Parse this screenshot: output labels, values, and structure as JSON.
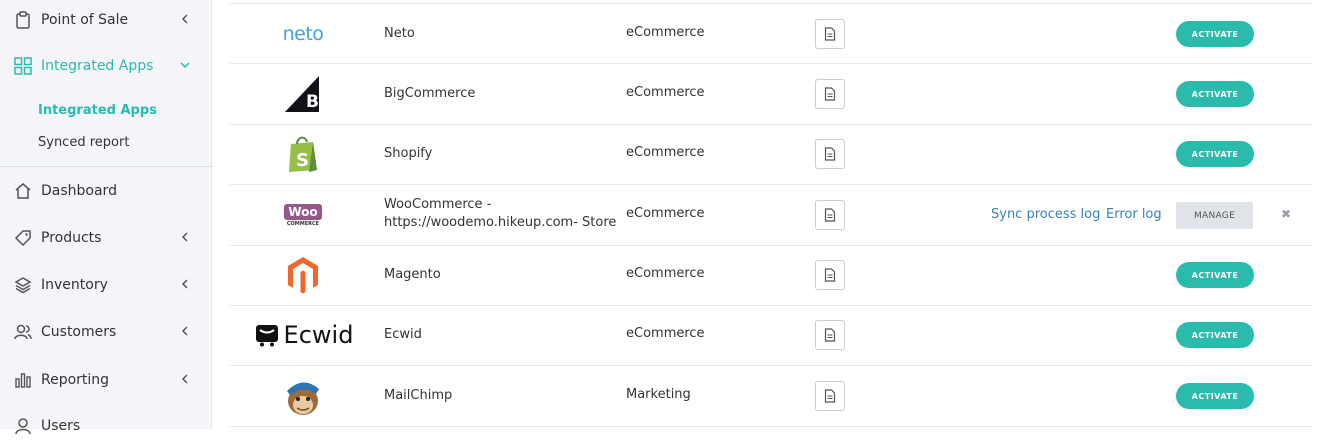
{
  "sidebar": {
    "items": [
      {
        "label": "Point of Sale",
        "icon": "clipboard-icon"
      },
      {
        "label": "Integrated Apps",
        "icon": "grid-icon"
      },
      {
        "label": "Dashboard",
        "icon": "home-icon"
      },
      {
        "label": "Products",
        "icon": "tag-icon"
      },
      {
        "label": "Inventory",
        "icon": "layers-icon"
      },
      {
        "label": "Customers",
        "icon": "users-icon"
      },
      {
        "label": "Reporting",
        "icon": "bar-chart-icon"
      },
      {
        "label": "Users",
        "icon": "user-icon"
      }
    ],
    "subitems": [
      {
        "label": "Integrated Apps"
      },
      {
        "label": "Synced report"
      }
    ]
  },
  "apps": [
    {
      "name": "Neto",
      "category": "eCommerce",
      "action": "ACTIVATE",
      "logo_text": "neto"
    },
    {
      "name": "BigCommerce",
      "category": "eCommerce",
      "action": "ACTIVATE"
    },
    {
      "name": "Shopify",
      "category": "eCommerce",
      "action": "ACTIVATE"
    },
    {
      "name_line1": "WooCommerce -",
      "name_line2": "https://woodemo.hikeup.com- Store",
      "category": "eCommerce",
      "action": "MANAGE",
      "sync_log": "Sync process log",
      "error_log": "Error log",
      "logo_text": "Woo",
      "logo_sub": "COMMERCE"
    },
    {
      "name": "Magento",
      "category": "eCommerce",
      "action": "ACTIVATE"
    },
    {
      "name": "Ecwid",
      "category": "eCommerce",
      "action": "ACTIVATE",
      "logo_text": "Ecwid"
    },
    {
      "name": "MailChimp",
      "category": "Marketing",
      "action": "ACTIVATE"
    }
  ],
  "colors": {
    "accent": "#2bbbad",
    "link": "#3a7ebd"
  }
}
